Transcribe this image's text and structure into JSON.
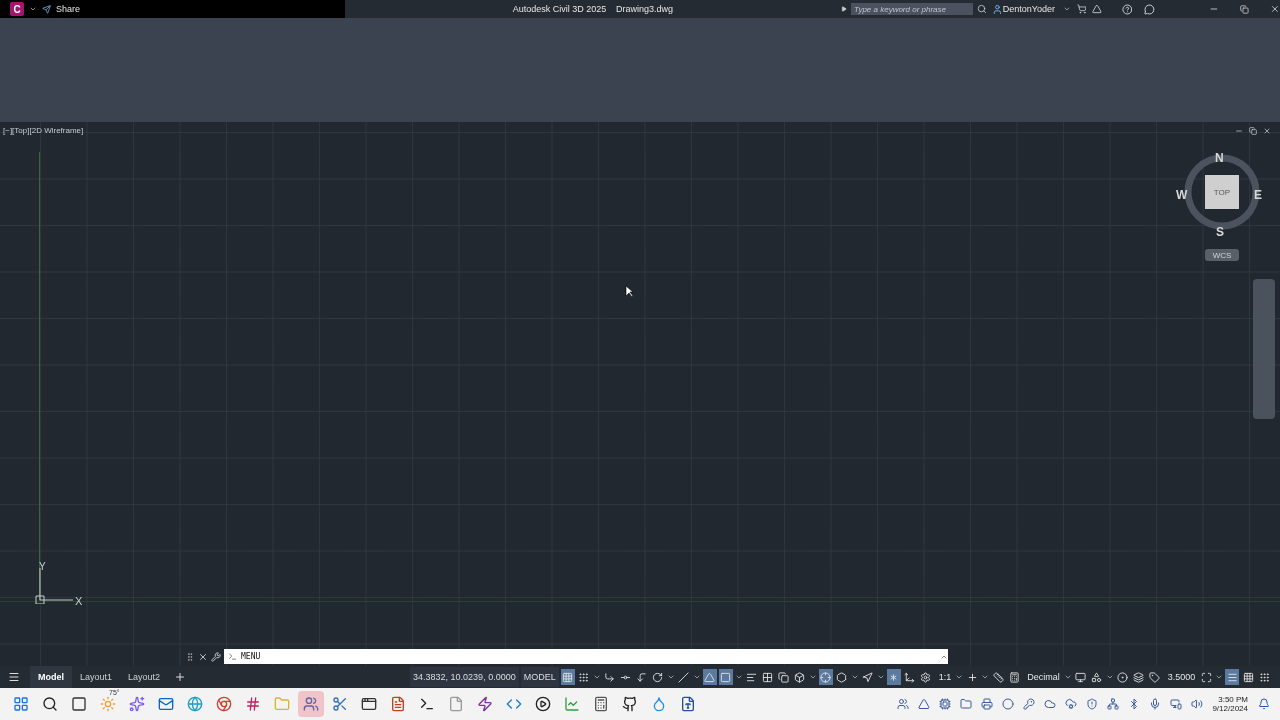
{
  "title_bar": {
    "app_letter": "C",
    "share": "Share",
    "app_title": "Autodesk Civil 3D 2025",
    "file_name": "Drawing3.dwg",
    "search": {
      "placeholder": "Type a keyword or phrase"
    },
    "user": "DentonYoder"
  },
  "viewport": {
    "label": "[−][Top][2D Wireframe]",
    "viewcube": {
      "north": "N",
      "south": "S",
      "west": "W",
      "east": "E",
      "face": "TOP",
      "ucs": "WCS"
    },
    "ucs_icon": {
      "y": "Y",
      "x": "X"
    }
  },
  "command_line": {
    "value": "MENU"
  },
  "layout_tabs": [
    {
      "label": "Model",
      "selected": true
    },
    {
      "label": "Layout1",
      "selected": false
    },
    {
      "label": "Layout2",
      "selected": false
    }
  ],
  "coordinates": "34.3832, 10.0239, 0.0000",
  "space": "MODEL",
  "status_items": [
    {
      "kind": "toggle",
      "on": true
    },
    {
      "kind": "toggle",
      "on": false
    },
    {
      "kind": "caret"
    },
    {
      "kind": "toggle",
      "on": false
    },
    {
      "kind": "toggle",
      "on": false
    },
    {
      "kind": "toggle",
      "on": false
    },
    {
      "kind": "toggle",
      "on": false
    },
    {
      "kind": "caret"
    },
    {
      "kind": "toggle",
      "on": false
    },
    {
      "kind": "caret"
    },
    {
      "kind": "toggle",
      "on": true
    },
    {
      "kind": "toggle",
      "on": true
    },
    {
      "kind": "caret"
    },
    {
      "kind": "toggle",
      "on": false
    },
    {
      "kind": "toggle",
      "on": false
    },
    {
      "kind": "toggle",
      "on": false
    },
    {
      "kind": "toggle",
      "on": false
    },
    {
      "kind": "caret"
    },
    {
      "kind": "toggle",
      "on": true
    },
    {
      "kind": "toggle",
      "on": false
    },
    {
      "kind": "caret"
    },
    {
      "kind": "toggle",
      "on": false
    },
    {
      "kind": "caret"
    },
    {
      "kind": "toggle",
      "on": true
    },
    {
      "kind": "toggle",
      "on": false
    },
    {
      "kind": "toggle",
      "on": false
    },
    {
      "kind": "text",
      "text": "1:1"
    },
    {
      "kind": "caret"
    },
    {
      "kind": "toggle",
      "on": false
    },
    {
      "kind": "caret"
    },
    {
      "kind": "toggle",
      "on": false
    },
    {
      "kind": "toggle",
      "on": false
    },
    {
      "kind": "text",
      "text": "Decimal"
    },
    {
      "kind": "caret"
    },
    {
      "kind": "toggle",
      "on": false
    },
    {
      "kind": "toggle",
      "on": false
    },
    {
      "kind": "caret"
    },
    {
      "kind": "toggle",
      "on": false
    },
    {
      "kind": "toggle",
      "on": false
    },
    {
      "kind": "toggle",
      "on": false
    },
    {
      "kind": "text",
      "text": "3.5000"
    },
    {
      "kind": "toggle",
      "on": false
    },
    {
      "kind": "caret"
    },
    {
      "kind": "toggle",
      "on": true
    },
    {
      "kind": "toggle",
      "on": false
    },
    {
      "kind": "toggle",
      "on": false
    }
  ],
  "taskbar": {
    "weather": "75°",
    "apps": [
      {
        "selected": false
      },
      {
        "selected": false
      },
      {
        "selected": false
      },
      {
        "selected": false
      },
      {
        "selected": false
      },
      {
        "selected": false
      },
      {
        "selected": false
      },
      {
        "selected": false
      },
      {
        "selected": false
      },
      {
        "selected": false
      },
      {
        "selected": true
      },
      {
        "selected": false
      },
      {
        "selected": false
      },
      {
        "selected": false
      },
      {
        "selected": false
      },
      {
        "selected": false
      },
      {
        "selected": false
      },
      {
        "selected": false
      },
      {
        "selected": false
      },
      {
        "selected": false
      },
      {
        "selected": false
      },
      {
        "selected": false
      },
      {
        "selected": false
      },
      {
        "selected": false
      }
    ],
    "time": "3:50 PM",
    "date": "9/12/2024"
  }
}
